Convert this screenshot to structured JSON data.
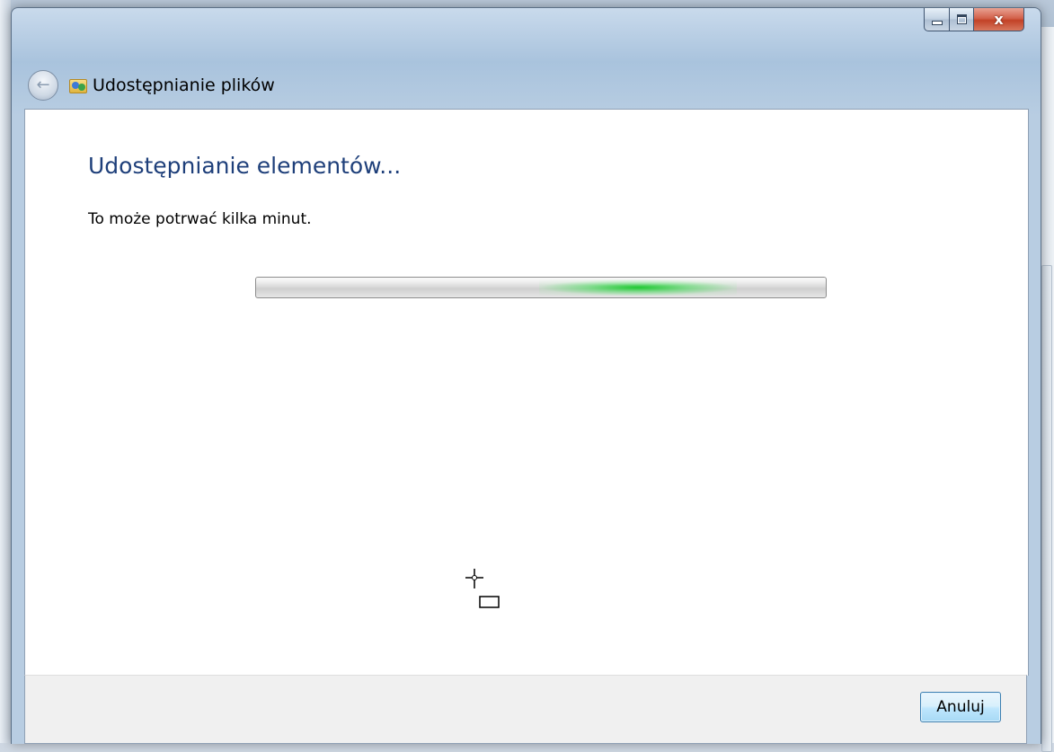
{
  "window": {
    "title": "Udostępnianie plików",
    "minimize_glyph": "",
    "maximize_glyph": "",
    "close_glyph": "x"
  },
  "content": {
    "heading": "Udostępnianie elementów...",
    "message": "To może potrwać kilka minut."
  },
  "progress": {
    "mode": "indeterminate",
    "glow_position": 0.67,
    "color": "#22c23a"
  },
  "footer": {
    "cancel_label": "Anuluj"
  },
  "icons": {
    "back": "back-arrow-icon",
    "title": "sharing-folder-icon",
    "cursor": "crosshair-cursor-icon"
  }
}
